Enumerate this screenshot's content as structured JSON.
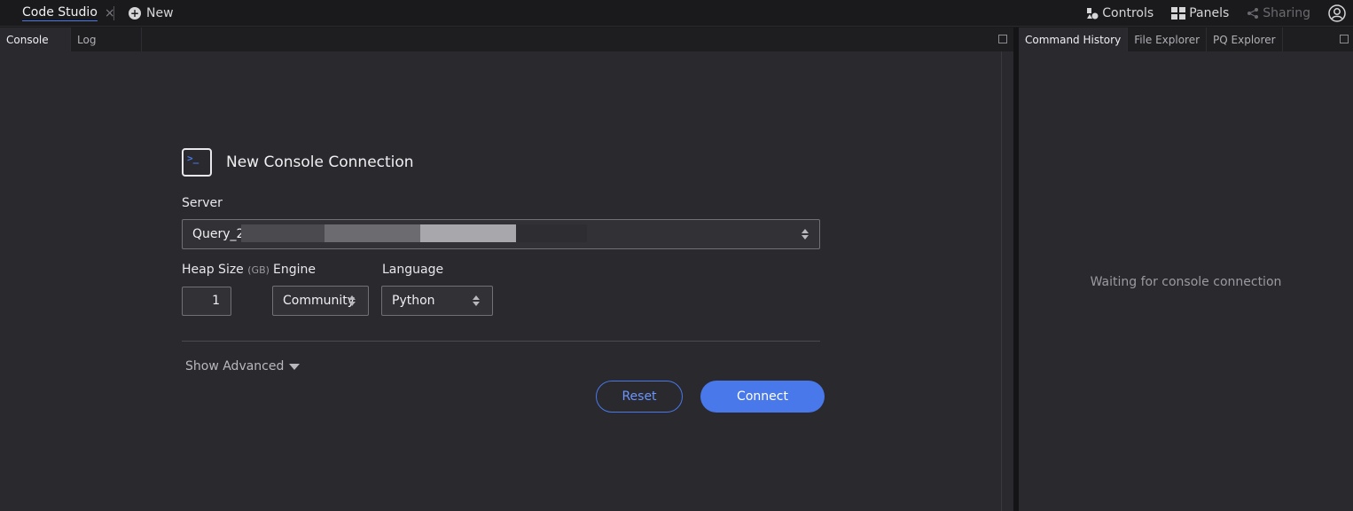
{
  "topbar": {
    "app_tab": "Code Studio",
    "close_glyph": "×",
    "new_label": "New",
    "controls_label": "Controls",
    "panels_label": "Panels",
    "sharing_label": "Sharing"
  },
  "left_panel": {
    "tabs": [
      {
        "label": "Console",
        "active": true
      },
      {
        "label": "Log",
        "active": false
      }
    ]
  },
  "right_panel": {
    "tabs": [
      {
        "label": "Command History",
        "active": true
      },
      {
        "label": "File Explorer",
        "active": false
      },
      {
        "label": "PQ Explorer",
        "active": false
      }
    ],
    "waiting_text": "Waiting for console connection"
  },
  "connection": {
    "icon_glyph": ">_",
    "title": "New Console Connection",
    "server_label": "Server",
    "server_value": "Query_2",
    "heap_label": "Heap Size",
    "heap_unit": "(GB)",
    "heap_value": "1",
    "engine_label": "Engine",
    "engine_value": "Community",
    "language_label": "Language",
    "language_value": "Python",
    "show_advanced": "Show Advanced",
    "reset_label": "Reset",
    "connect_label": "Connect"
  },
  "colors": {
    "accent": "#4878ea",
    "background": "#2a292e",
    "chrome": "#1a1a1c"
  }
}
